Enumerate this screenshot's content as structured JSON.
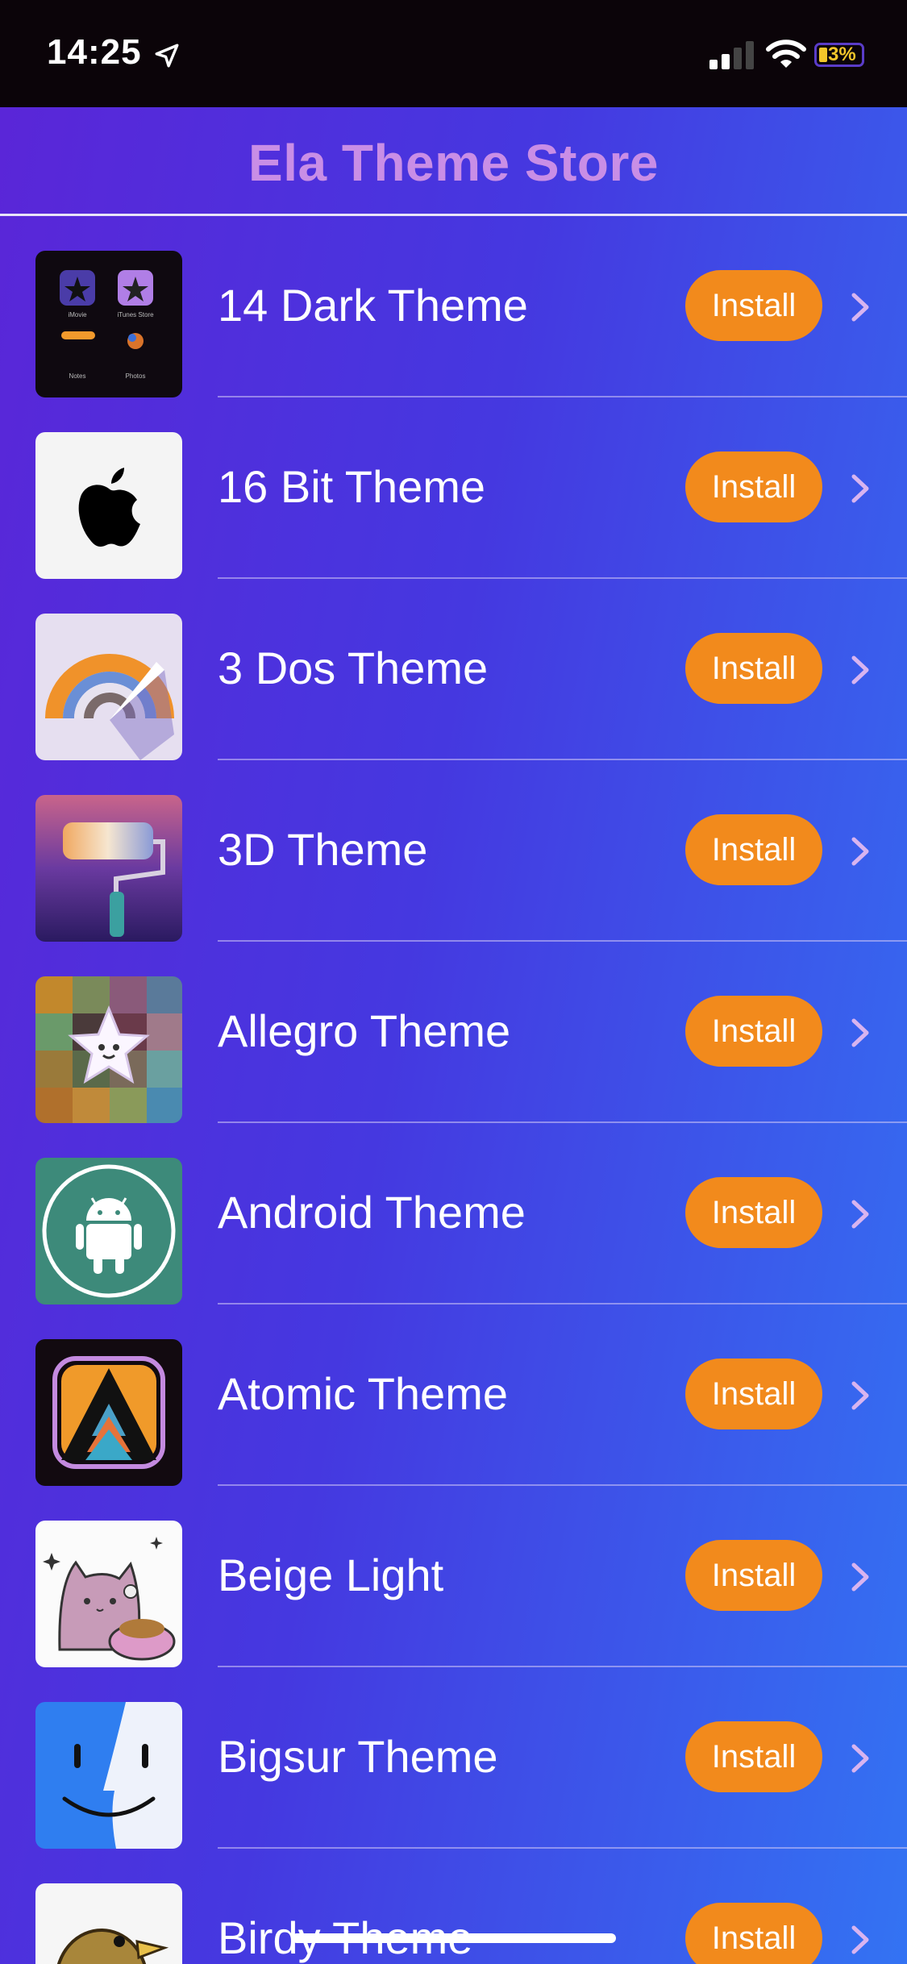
{
  "status_bar": {
    "time": "14:25",
    "battery_text": "3%",
    "battery_level": 0.03
  },
  "header": {
    "title": "Ela Theme Store"
  },
  "install_label": "Install",
  "themes": [
    {
      "name": "14 Dark Theme",
      "install": "Install",
      "icon": "dark-theme-icon"
    },
    {
      "name": "16 Bit Theme",
      "install": "Install",
      "icon": "apple-logo-icon"
    },
    {
      "name": "3 Dos Theme",
      "install": "Install",
      "icon": "rainbow-gauge-icon"
    },
    {
      "name": "3D Theme",
      "install": "Install",
      "icon": "paint-roller-icon"
    },
    {
      "name": "Allegro Theme",
      "install": "Install",
      "icon": "star-character-icon"
    },
    {
      "name": "Android Theme",
      "install": "Install",
      "icon": "android-robot-icon"
    },
    {
      "name": "Atomic Theme",
      "install": "Install",
      "icon": "atomic-triangle-icon"
    },
    {
      "name": "Beige Light",
      "install": "Install",
      "icon": "pusheen-cat-icon"
    },
    {
      "name": "Bigsur Theme",
      "install": "Install",
      "icon": "finder-face-icon"
    },
    {
      "name": "Birdy Theme",
      "install": "Install",
      "icon": "bird-icon"
    }
  ],
  "colors": {
    "install_button": "#f28a1c",
    "header_title": "#c98ee6",
    "gradient_start": "#5a26d8",
    "gradient_end": "#3373f3"
  }
}
